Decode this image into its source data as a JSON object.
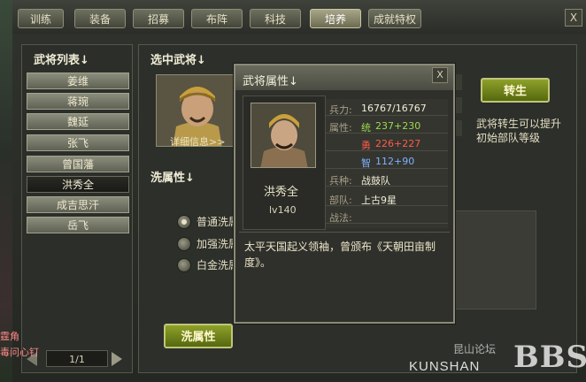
{
  "tabs": [
    {
      "label": "训练",
      "active": false
    },
    {
      "label": "装备",
      "active": false
    },
    {
      "label": "招募",
      "active": false
    },
    {
      "label": "布阵",
      "active": false
    },
    {
      "label": "科技",
      "active": false
    },
    {
      "label": "培养",
      "active": true
    },
    {
      "label": "成就特权",
      "active": false
    }
  ],
  "close_label": "X",
  "left": {
    "title": "武将列表↓",
    "generals": [
      "姜维",
      "蒋琬",
      "魏延",
      "张飞",
      "曾国藩",
      "洪秀全",
      "成吉思汗",
      "岳飞"
    ],
    "selected_index": 5,
    "pager": "1/1"
  },
  "center": {
    "selected_title": "选中武将↓",
    "detail_link": "详细信息>>",
    "wash_title": "洗属性↓",
    "options": [
      "普通洗属",
      "加强洗属",
      "白金洗属"
    ],
    "selected_option": 0,
    "wash_button": "洗属性",
    "rebirth_button": "转生",
    "rebirth_desc": "武将转生可以提升初始部队等级"
  },
  "popup": {
    "title": "武将属性↓",
    "close_label": "X",
    "name": "洪秀全",
    "level": "lv140",
    "stats": {
      "hp_label": "兵力:",
      "hp_value": "16767/16767",
      "attr_label": "属性:",
      "tong_label": "统",
      "tong_value": "237+230",
      "yong_label": "勇",
      "yong_value": "226+227",
      "zhi_label": "智",
      "zhi_value": "112+90",
      "type_label": "兵种:",
      "type_value": "战鼓队",
      "unit_label": "部队:",
      "unit_value": "上古9星",
      "tactic_label": "战法:",
      "tactic_value": ""
    },
    "bio": "太平天国起义领袖，曾颁布《天朝田亩制度》。"
  },
  "edge_texts": [
    "霆角",
    "毒问心钉"
  ],
  "watermark": {
    "cn": "昆山论坛",
    "bbs": "BBS",
    "kunshan": "KUNSHAN"
  },
  "colors": {
    "accent_green": "#8ea12a",
    "stat_green": "#9cd94c",
    "stat_red": "#ff5a4e",
    "stat_blue": "#7fb0ff"
  }
}
